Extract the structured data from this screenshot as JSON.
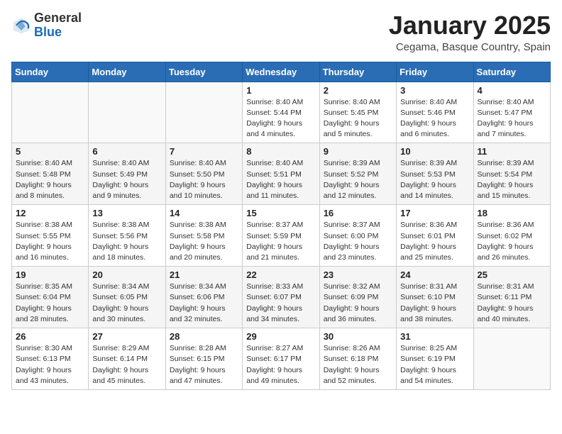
{
  "header": {
    "logo": {
      "general": "General",
      "blue": "Blue"
    },
    "title": "January 2025",
    "location": "Cegama, Basque Country, Spain"
  },
  "weekdays": [
    "Sunday",
    "Monday",
    "Tuesday",
    "Wednesday",
    "Thursday",
    "Friday",
    "Saturday"
  ],
  "weeks": [
    [
      {
        "day": "",
        "sunrise": "",
        "sunset": "",
        "daylight": ""
      },
      {
        "day": "",
        "sunrise": "",
        "sunset": "",
        "daylight": ""
      },
      {
        "day": "",
        "sunrise": "",
        "sunset": "",
        "daylight": ""
      },
      {
        "day": "1",
        "sunrise": "Sunrise: 8:40 AM",
        "sunset": "Sunset: 5:44 PM",
        "daylight": "Daylight: 9 hours and 4 minutes."
      },
      {
        "day": "2",
        "sunrise": "Sunrise: 8:40 AM",
        "sunset": "Sunset: 5:45 PM",
        "daylight": "Daylight: 9 hours and 5 minutes."
      },
      {
        "day": "3",
        "sunrise": "Sunrise: 8:40 AM",
        "sunset": "Sunset: 5:46 PM",
        "daylight": "Daylight: 9 hours and 6 minutes."
      },
      {
        "day": "4",
        "sunrise": "Sunrise: 8:40 AM",
        "sunset": "Sunset: 5:47 PM",
        "daylight": "Daylight: 9 hours and 7 minutes."
      }
    ],
    [
      {
        "day": "5",
        "sunrise": "Sunrise: 8:40 AM",
        "sunset": "Sunset: 5:48 PM",
        "daylight": "Daylight: 9 hours and 8 minutes."
      },
      {
        "day": "6",
        "sunrise": "Sunrise: 8:40 AM",
        "sunset": "Sunset: 5:49 PM",
        "daylight": "Daylight: 9 hours and 9 minutes."
      },
      {
        "day": "7",
        "sunrise": "Sunrise: 8:40 AM",
        "sunset": "Sunset: 5:50 PM",
        "daylight": "Daylight: 9 hours and 10 minutes."
      },
      {
        "day": "8",
        "sunrise": "Sunrise: 8:40 AM",
        "sunset": "Sunset: 5:51 PM",
        "daylight": "Daylight: 9 hours and 11 minutes."
      },
      {
        "day": "9",
        "sunrise": "Sunrise: 8:39 AM",
        "sunset": "Sunset: 5:52 PM",
        "daylight": "Daylight: 9 hours and 12 minutes."
      },
      {
        "day": "10",
        "sunrise": "Sunrise: 8:39 AM",
        "sunset": "Sunset: 5:53 PM",
        "daylight": "Daylight: 9 hours and 14 minutes."
      },
      {
        "day": "11",
        "sunrise": "Sunrise: 8:39 AM",
        "sunset": "Sunset: 5:54 PM",
        "daylight": "Daylight: 9 hours and 15 minutes."
      }
    ],
    [
      {
        "day": "12",
        "sunrise": "Sunrise: 8:38 AM",
        "sunset": "Sunset: 5:55 PM",
        "daylight": "Daylight: 9 hours and 16 minutes."
      },
      {
        "day": "13",
        "sunrise": "Sunrise: 8:38 AM",
        "sunset": "Sunset: 5:56 PM",
        "daylight": "Daylight: 9 hours and 18 minutes."
      },
      {
        "day": "14",
        "sunrise": "Sunrise: 8:38 AM",
        "sunset": "Sunset: 5:58 PM",
        "daylight": "Daylight: 9 hours and 20 minutes."
      },
      {
        "day": "15",
        "sunrise": "Sunrise: 8:37 AM",
        "sunset": "Sunset: 5:59 PM",
        "daylight": "Daylight: 9 hours and 21 minutes."
      },
      {
        "day": "16",
        "sunrise": "Sunrise: 8:37 AM",
        "sunset": "Sunset: 6:00 PM",
        "daylight": "Daylight: 9 hours and 23 minutes."
      },
      {
        "day": "17",
        "sunrise": "Sunrise: 8:36 AM",
        "sunset": "Sunset: 6:01 PM",
        "daylight": "Daylight: 9 hours and 25 minutes."
      },
      {
        "day": "18",
        "sunrise": "Sunrise: 8:36 AM",
        "sunset": "Sunset: 6:02 PM",
        "daylight": "Daylight: 9 hours and 26 minutes."
      }
    ],
    [
      {
        "day": "19",
        "sunrise": "Sunrise: 8:35 AM",
        "sunset": "Sunset: 6:04 PM",
        "daylight": "Daylight: 9 hours and 28 minutes."
      },
      {
        "day": "20",
        "sunrise": "Sunrise: 8:34 AM",
        "sunset": "Sunset: 6:05 PM",
        "daylight": "Daylight: 9 hours and 30 minutes."
      },
      {
        "day": "21",
        "sunrise": "Sunrise: 8:34 AM",
        "sunset": "Sunset: 6:06 PM",
        "daylight": "Daylight: 9 hours and 32 minutes."
      },
      {
        "day": "22",
        "sunrise": "Sunrise: 8:33 AM",
        "sunset": "Sunset: 6:07 PM",
        "daylight": "Daylight: 9 hours and 34 minutes."
      },
      {
        "day": "23",
        "sunrise": "Sunrise: 8:32 AM",
        "sunset": "Sunset: 6:09 PM",
        "daylight": "Daylight: 9 hours and 36 minutes."
      },
      {
        "day": "24",
        "sunrise": "Sunrise: 8:31 AM",
        "sunset": "Sunset: 6:10 PM",
        "daylight": "Daylight: 9 hours and 38 minutes."
      },
      {
        "day": "25",
        "sunrise": "Sunrise: 8:31 AM",
        "sunset": "Sunset: 6:11 PM",
        "daylight": "Daylight: 9 hours and 40 minutes."
      }
    ],
    [
      {
        "day": "26",
        "sunrise": "Sunrise: 8:30 AM",
        "sunset": "Sunset: 6:13 PM",
        "daylight": "Daylight: 9 hours and 43 minutes."
      },
      {
        "day": "27",
        "sunrise": "Sunrise: 8:29 AM",
        "sunset": "Sunset: 6:14 PM",
        "daylight": "Daylight: 9 hours and 45 minutes."
      },
      {
        "day": "28",
        "sunrise": "Sunrise: 8:28 AM",
        "sunset": "Sunset: 6:15 PM",
        "daylight": "Daylight: 9 hours and 47 minutes."
      },
      {
        "day": "29",
        "sunrise": "Sunrise: 8:27 AM",
        "sunset": "Sunset: 6:17 PM",
        "daylight": "Daylight: 9 hours and 49 minutes."
      },
      {
        "day": "30",
        "sunrise": "Sunrise: 8:26 AM",
        "sunset": "Sunset: 6:18 PM",
        "daylight": "Daylight: 9 hours and 52 minutes."
      },
      {
        "day": "31",
        "sunrise": "Sunrise: 8:25 AM",
        "sunset": "Sunset: 6:19 PM",
        "daylight": "Daylight: 9 hours and 54 minutes."
      },
      {
        "day": "",
        "sunrise": "",
        "sunset": "",
        "daylight": ""
      }
    ]
  ]
}
